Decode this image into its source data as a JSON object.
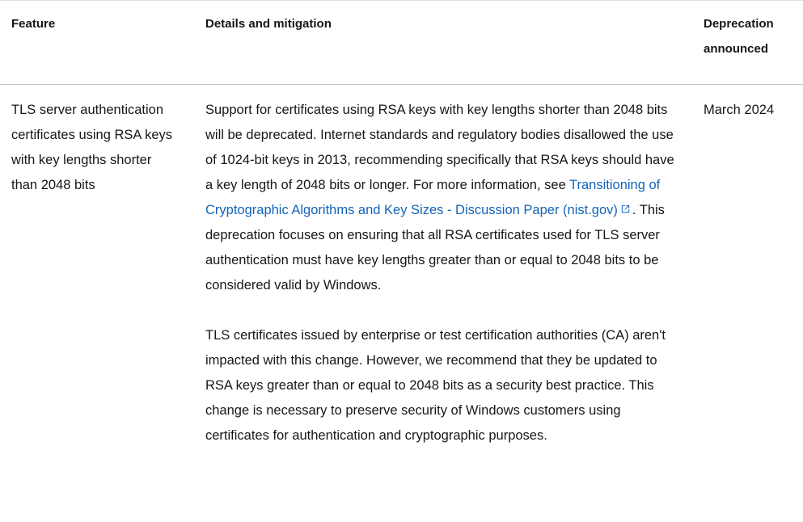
{
  "table": {
    "headers": [
      {
        "label": "Feature"
      },
      {
        "label": "Details and mitigation"
      },
      {
        "label": "Deprecation\nannounced"
      }
    ],
    "header_announced_line1": "Deprecation",
    "header_announced_line2": "announced",
    "rows": [
      {
        "feature": "TLS server authentication certificates using RSA keys with key lengths shorter than 2048 bits",
        "details": {
          "paragraph1_before_link": "Support for certificates using RSA keys with key lengths shorter than 2048 bits will be deprecated. Internet standards and regulatory bodies disallowed the use of 1024-bit keys in 2013, recommending specifically that RSA keys should have a key length of 2048 bits or longer. For more information, see ",
          "link_text": "Transitioning of Cryptographic Algorithms and Key Sizes - Discussion Paper (nist.gov)",
          "link_icon": "external-link-icon",
          "paragraph1_after_link": ". This deprecation focuses on ensuring that all RSA certificates used for TLS server authentication must have key lengths greater than or equal to 2048 bits to be considered valid by Windows.",
          "paragraph2": "TLS certificates issued by enterprise or test certification authorities (CA) aren't impacted with this change. However, we recommend that they be updated to RSA keys greater than or equal to 2048 bits as a security best practice. This change is necessary to preserve security of Windows customers using certificates for authentication and cryptographic purposes."
        },
        "announced": "March 2024"
      }
    ]
  },
  "colors": {
    "link": "#1364b8",
    "text": "#171717",
    "header_text": "#161616",
    "rule": "#c8c6c4",
    "background": "#ffffff"
  }
}
